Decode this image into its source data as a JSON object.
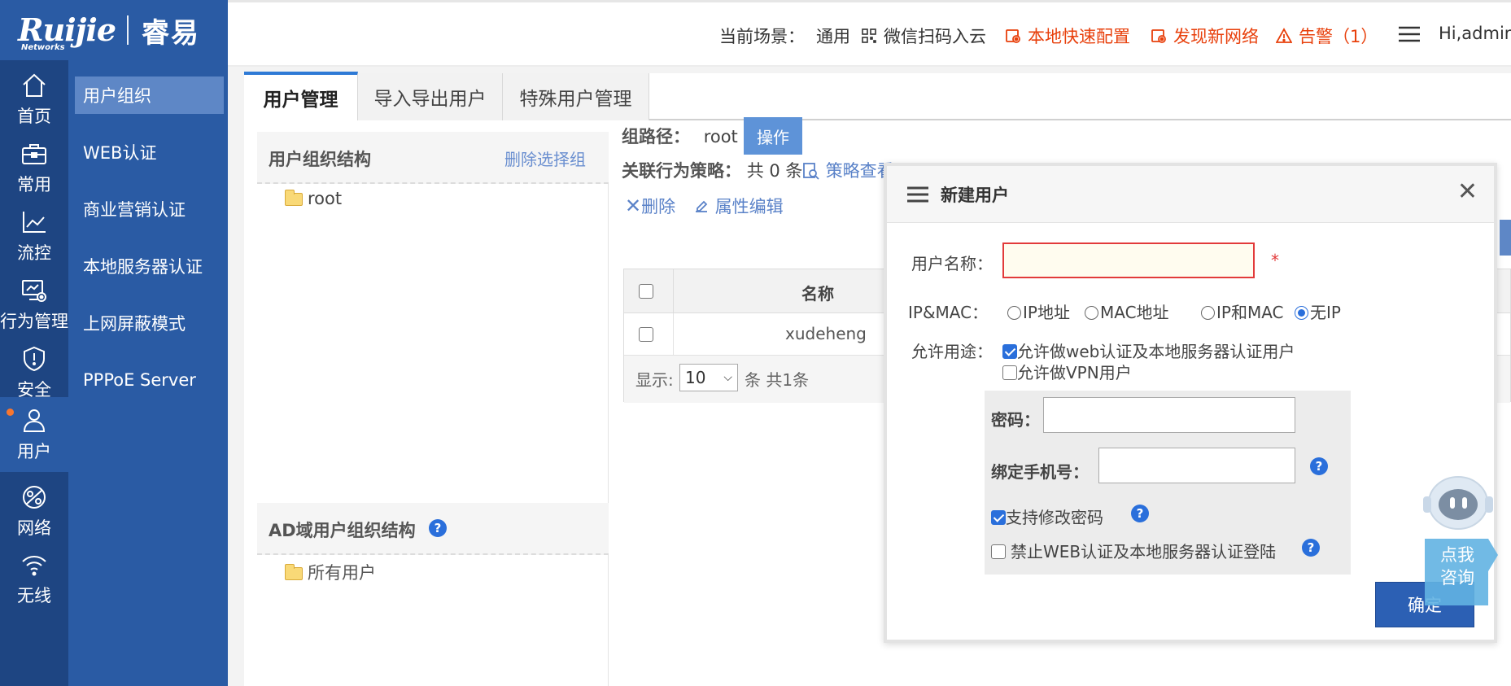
{
  "brand": {
    "logo_text": "Ruijie",
    "logo_sub": "Networks",
    "product": "睿易"
  },
  "header": {
    "scene_label": "当前场景：",
    "scene_value": "通用",
    "wechat": "微信扫码入云",
    "quick_config": "本地快速配置",
    "discover": "发现新网络",
    "alarm": "告警（1）",
    "user": "Hi,admin"
  },
  "rail": [
    {
      "label": "首页",
      "icon": "home-icon"
    },
    {
      "label": "常用",
      "icon": "briefcase-icon"
    },
    {
      "label": "流控",
      "icon": "chart-icon"
    },
    {
      "label": "行为管理",
      "icon": "monitor-gear-icon"
    },
    {
      "label": "安全",
      "icon": "shield-icon"
    },
    {
      "label": "用户",
      "icon": "user-icon",
      "active": true
    },
    {
      "label": "网络",
      "icon": "globe-icon"
    },
    {
      "label": "无线",
      "icon": "wifi-icon"
    }
  ],
  "submenu": [
    {
      "label": "用户组织",
      "active": true
    },
    {
      "label": "WEB认证"
    },
    {
      "label": "商业营销认证"
    },
    {
      "label": "本地服务器认证"
    },
    {
      "label": "上网屏蔽模式"
    },
    {
      "label": "PPPoE Server"
    }
  ],
  "tabs": [
    {
      "label": "用户管理",
      "active": true
    },
    {
      "label": "导入导出用户"
    },
    {
      "label": "特殊用户管理"
    }
  ],
  "tree": {
    "title": "用户组织结构",
    "delete_link": "删除选择组",
    "root": "root",
    "ad_title": "AD域用户组织结构",
    "ad_item": "所有用户"
  },
  "group": {
    "path_label": "组路径：",
    "path_value": "root",
    "op_button": "操作",
    "policy_label": "关联行为策略：",
    "policy_count": "共 0 条",
    "policy_view": "策略查看",
    "delete": "删除",
    "edit_attr": "属性编辑"
  },
  "grid": {
    "col_name": "名称",
    "rows": [
      {
        "name": "xudeheng"
      }
    ],
    "show_label": "显示:",
    "page_size": "10",
    "count_text": "条 共1条"
  },
  "dialog": {
    "title": "新建用户",
    "username_label": "用户名称：",
    "username_value": "",
    "required_mark": "*",
    "ipmac_label": "IP&MAC：",
    "ipmac_options": [
      "IP地址",
      "MAC地址",
      "IP和MAC",
      "无IP"
    ],
    "ipmac_selected": "无IP",
    "usage_label": "允许用途：",
    "usage_web": "允许做web认证及本地服务器认证用户",
    "usage_web_checked": true,
    "usage_vpn": "允许做VPN用户",
    "usage_vpn_checked": false,
    "password_label": "密码：",
    "phone_label": "绑定手机号：",
    "change_pwd": "支持修改密码",
    "change_pwd_checked": true,
    "forbid_login": "禁止WEB认证及本地服务器认证登陆",
    "forbid_login_checked": false,
    "confirm": "确定"
  },
  "robot": {
    "line1": "点我",
    "line2": "咨询"
  },
  "colors": {
    "brand": "#2a5ba4",
    "rail": "#1e4582",
    "accent": "#2a6fdb",
    "alert": "#e8400c"
  }
}
